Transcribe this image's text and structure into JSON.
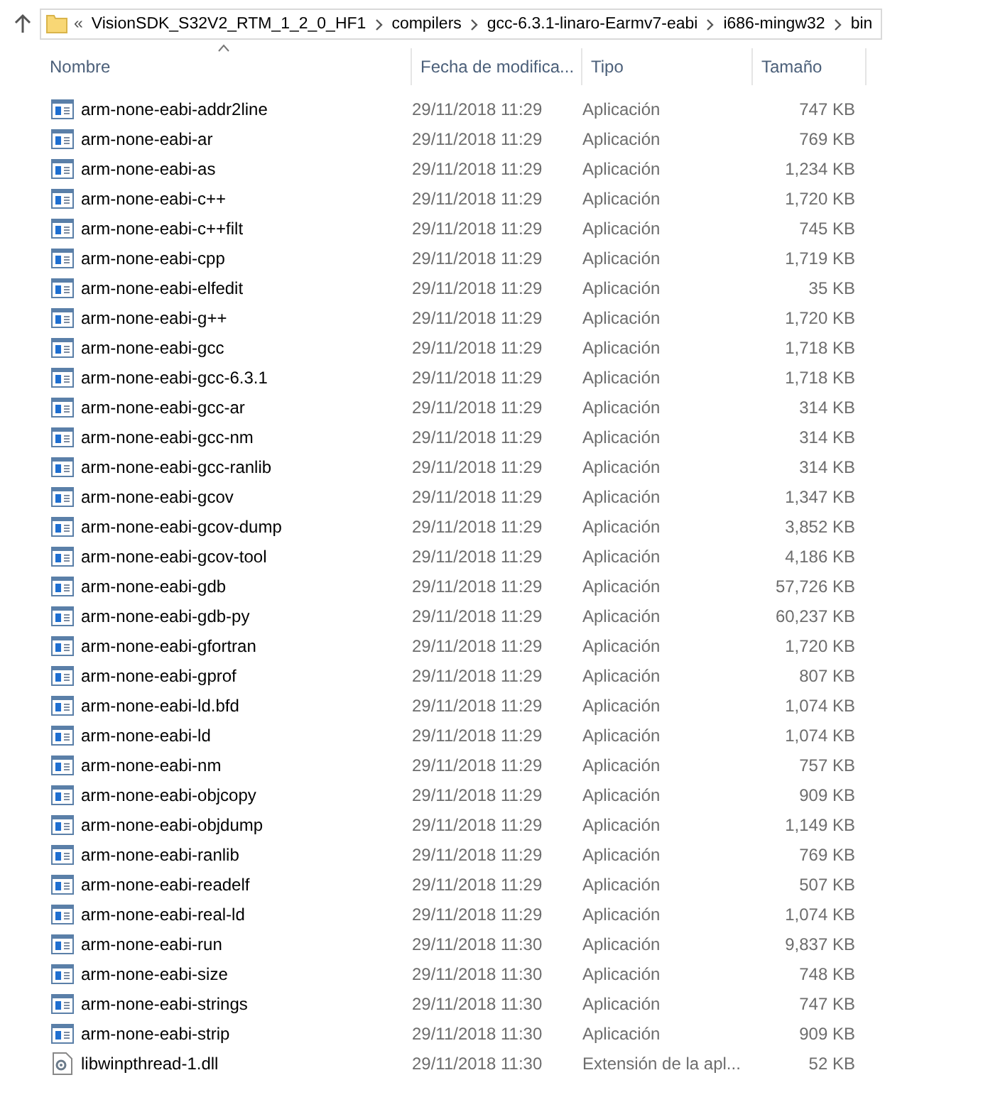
{
  "address_bar": {
    "overflow": "«",
    "path": [
      "VisionSDK_S32V2_RTM_1_2_0_HF1",
      "compilers",
      "gcc-6.3.1-linaro-Earmv7-eabi",
      "i686-mingw32",
      "bin"
    ]
  },
  "columns": [
    {
      "label": "Nombre",
      "sorted": true
    },
    {
      "label": "Fecha de modifica...",
      "sorted": false
    },
    {
      "label": "Tipo",
      "sorted": false
    },
    {
      "label": "Tamaño",
      "sorted": false
    }
  ],
  "files": [
    {
      "kind": "app",
      "name": "arm-none-eabi-addr2line",
      "date": "29/11/2018 11:29",
      "type": "Aplicación",
      "size": "747 KB"
    },
    {
      "kind": "app",
      "name": "arm-none-eabi-ar",
      "date": "29/11/2018 11:29",
      "type": "Aplicación",
      "size": "769 KB"
    },
    {
      "kind": "app",
      "name": "arm-none-eabi-as",
      "date": "29/11/2018 11:29",
      "type": "Aplicación",
      "size": "1,234 KB"
    },
    {
      "kind": "app",
      "name": "arm-none-eabi-c++",
      "date": "29/11/2018 11:29",
      "type": "Aplicación",
      "size": "1,720 KB"
    },
    {
      "kind": "app",
      "name": "arm-none-eabi-c++filt",
      "date": "29/11/2018 11:29",
      "type": "Aplicación",
      "size": "745 KB"
    },
    {
      "kind": "app",
      "name": "arm-none-eabi-cpp",
      "date": "29/11/2018 11:29",
      "type": "Aplicación",
      "size": "1,719 KB"
    },
    {
      "kind": "app",
      "name": "arm-none-eabi-elfedit",
      "date": "29/11/2018 11:29",
      "type": "Aplicación",
      "size": "35 KB"
    },
    {
      "kind": "app",
      "name": "arm-none-eabi-g++",
      "date": "29/11/2018 11:29",
      "type": "Aplicación",
      "size": "1,720 KB"
    },
    {
      "kind": "app",
      "name": "arm-none-eabi-gcc",
      "date": "29/11/2018 11:29",
      "type": "Aplicación",
      "size": "1,718 KB"
    },
    {
      "kind": "app",
      "name": "arm-none-eabi-gcc-6.3.1",
      "date": "29/11/2018 11:29",
      "type": "Aplicación",
      "size": "1,718 KB"
    },
    {
      "kind": "app",
      "name": "arm-none-eabi-gcc-ar",
      "date": "29/11/2018 11:29",
      "type": "Aplicación",
      "size": "314 KB"
    },
    {
      "kind": "app",
      "name": "arm-none-eabi-gcc-nm",
      "date": "29/11/2018 11:29",
      "type": "Aplicación",
      "size": "314 KB"
    },
    {
      "kind": "app",
      "name": "arm-none-eabi-gcc-ranlib",
      "date": "29/11/2018 11:29",
      "type": "Aplicación",
      "size": "314 KB"
    },
    {
      "kind": "app",
      "name": "arm-none-eabi-gcov",
      "date": "29/11/2018 11:29",
      "type": "Aplicación",
      "size": "1,347 KB"
    },
    {
      "kind": "app",
      "name": "arm-none-eabi-gcov-dump",
      "date": "29/11/2018 11:29",
      "type": "Aplicación",
      "size": "3,852 KB"
    },
    {
      "kind": "app",
      "name": "arm-none-eabi-gcov-tool",
      "date": "29/11/2018 11:29",
      "type": "Aplicación",
      "size": "4,186 KB"
    },
    {
      "kind": "app",
      "name": "arm-none-eabi-gdb",
      "date": "29/11/2018 11:29",
      "type": "Aplicación",
      "size": "57,726 KB"
    },
    {
      "kind": "app",
      "name": "arm-none-eabi-gdb-py",
      "date": "29/11/2018 11:29",
      "type": "Aplicación",
      "size": "60,237 KB"
    },
    {
      "kind": "app",
      "name": "arm-none-eabi-gfortran",
      "date": "29/11/2018 11:29",
      "type": "Aplicación",
      "size": "1,720 KB"
    },
    {
      "kind": "app",
      "name": "arm-none-eabi-gprof",
      "date": "29/11/2018 11:29",
      "type": "Aplicación",
      "size": "807 KB"
    },
    {
      "kind": "app",
      "name": "arm-none-eabi-ld.bfd",
      "date": "29/11/2018 11:29",
      "type": "Aplicación",
      "size": "1,074 KB"
    },
    {
      "kind": "app",
      "name": "arm-none-eabi-ld",
      "date": "29/11/2018 11:29",
      "type": "Aplicación",
      "size": "1,074 KB"
    },
    {
      "kind": "app",
      "name": "arm-none-eabi-nm",
      "date": "29/11/2018 11:29",
      "type": "Aplicación",
      "size": "757 KB"
    },
    {
      "kind": "app",
      "name": "arm-none-eabi-objcopy",
      "date": "29/11/2018 11:29",
      "type": "Aplicación",
      "size": "909 KB"
    },
    {
      "kind": "app",
      "name": "arm-none-eabi-objdump",
      "date": "29/11/2018 11:29",
      "type": "Aplicación",
      "size": "1,149 KB"
    },
    {
      "kind": "app",
      "name": "arm-none-eabi-ranlib",
      "date": "29/11/2018 11:29",
      "type": "Aplicación",
      "size": "769 KB"
    },
    {
      "kind": "app",
      "name": "arm-none-eabi-readelf",
      "date": "29/11/2018 11:29",
      "type": "Aplicación",
      "size": "507 KB"
    },
    {
      "kind": "app",
      "name": "arm-none-eabi-real-ld",
      "date": "29/11/2018 11:29",
      "type": "Aplicación",
      "size": "1,074 KB"
    },
    {
      "kind": "app",
      "name": "arm-none-eabi-run",
      "date": "29/11/2018 11:30",
      "type": "Aplicación",
      "size": "9,837 KB"
    },
    {
      "kind": "app",
      "name": "arm-none-eabi-size",
      "date": "29/11/2018 11:30",
      "type": "Aplicación",
      "size": "748 KB"
    },
    {
      "kind": "app",
      "name": "arm-none-eabi-strings",
      "date": "29/11/2018 11:30",
      "type": "Aplicación",
      "size": "747 KB"
    },
    {
      "kind": "app",
      "name": "arm-none-eabi-strip",
      "date": "29/11/2018 11:30",
      "type": "Aplicación",
      "size": "909 KB"
    },
    {
      "kind": "dll",
      "name": "libwinpthread-1.dll",
      "date": "29/11/2018 11:30",
      "type": "Extensión de la apl...",
      "size": "52 KB"
    }
  ]
}
